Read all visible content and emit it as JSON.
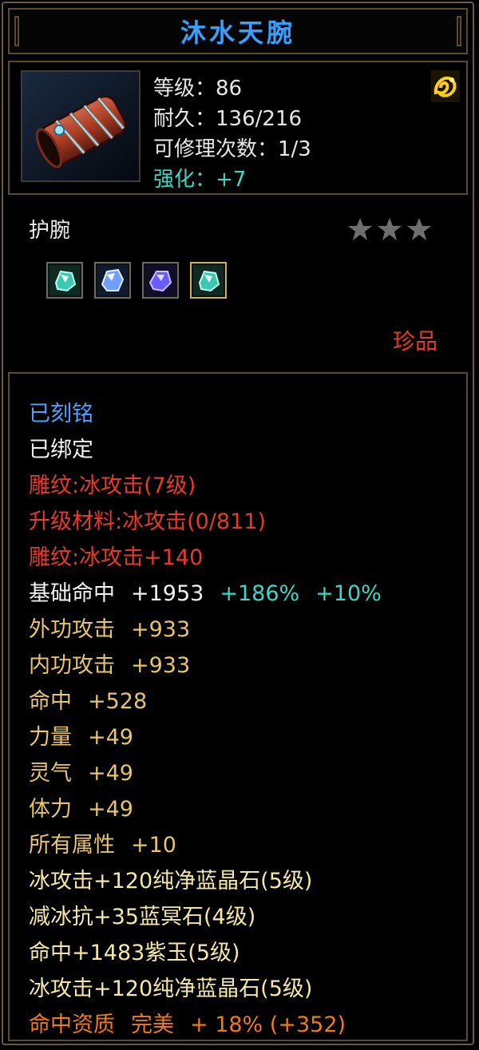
{
  "item": {
    "name": "沐水天腕",
    "level_label": "等级：86",
    "durability_label": "耐久：136/216",
    "repair_label": "可修理次数：1/3",
    "enhance_label": "强化：+7",
    "type": "护腕",
    "rarity": "珍品",
    "stars_shown": 3,
    "gems": [
      {
        "icon": "cyan-crystal-gem-icon",
        "color": "#3cc7b0"
      },
      {
        "icon": "blue-crystal-gem-icon",
        "color": "#6fa0ff"
      },
      {
        "icon": "purple-crystal-gem-icon",
        "color": "#6a5bff"
      },
      {
        "icon": "cyan-crystal-gem-icon",
        "color": "#3cc7b0"
      }
    ]
  },
  "attributes": {
    "engraved": "已刻铭",
    "bound": "已绑定",
    "carve1": "雕纹:冰攻击(7级)",
    "upgrade_material": "升级材料:冰攻击(0/811)",
    "carve2": "雕纹:冰攻击+140",
    "base_hit_label": "基础命中",
    "base_hit_value": "+1953",
    "base_hit_pct1": "+186%",
    "base_hit_pct2": "+10%",
    "ext_attack_label": "外功攻击",
    "ext_attack_value": "+933",
    "int_attack_label": "内功攻击",
    "int_attack_value": "+933",
    "hit_label": "命中",
    "hit_value": "+528",
    "str_label": "力量",
    "str_value": "+49",
    "spirit_label": "灵气",
    "spirit_value": "+49",
    "stamina_label": "体力",
    "stamina_value": "+49",
    "all_attr_label": "所有属性",
    "all_attr_value": "+10",
    "gem1": "冰攻击+120纯净蓝晶石(5级)",
    "gem2": "减冰抗+35蓝冥石(4级)",
    "gem3": "命中+1483紫玉(5级)",
    "gem4": "冰攻击+120纯净蓝晶石(5级)",
    "quality_label": "命中资质",
    "quality_grade": "完美",
    "quality_value": "+ 18% (+352)"
  },
  "colors": {
    "title": "#3aa0ff",
    "engraved": "#4da0ff",
    "red": "#e8392a",
    "gold": "#e8c46e",
    "cyan": "#39d9c8",
    "orange": "#f07a1a"
  }
}
